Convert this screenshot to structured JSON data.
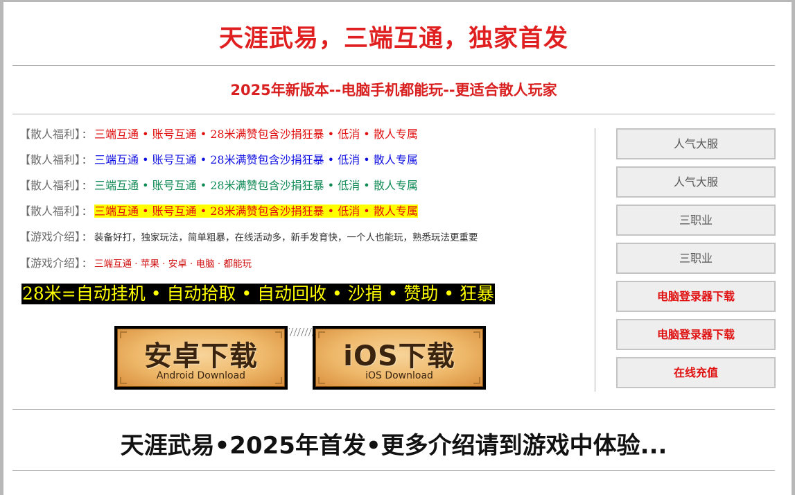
{
  "header": {
    "title": "天涯武易，三端互通，独家首发",
    "subtitle": "2025年新版本--电脑手机都能玩--更适合散人玩家"
  },
  "info_lines": [
    {
      "prefix": "【散人福利】",
      "sep": "：",
      "text": "三端互通 • 账号互通 • 28米满赞包含沙捐狂暴 • 低消 • 散人专属"
    },
    {
      "prefix": "【散人福利】",
      "sep": "：",
      "text": "三端互通 • 账号互通 • 28米满赞包含沙捐狂暴 • 低消 • 散人专属"
    },
    {
      "prefix": "【散人福利】",
      "sep": "：",
      "text": "三端互通 • 账号互通 • 28米满赞包含沙捐狂暴 • 低消 • 散人专属"
    },
    {
      "prefix": "【散人福利】",
      "sep": "：",
      "text": "三端互通 • 账号互通 • 28米满赞包含沙捐狂暴 • 低消 • 散人专属"
    },
    {
      "prefix": "【游戏介绍】",
      "sep": "：",
      "text": "装备好打，独家玩法，简单粗暴，在线活动多，新手发育快，一个人也能玩，熟悉玩法更重要"
    },
    {
      "prefix": "【游戏介绍】",
      "sep": "：",
      "text": "三端互通 · 苹果 · 安卓 · 电脑 · 都能玩"
    }
  ],
  "banner": "28米=自动挂机 • 自动拾取 • 自动回收 • 沙捐 • 赞助 • 狂暴",
  "downloads": {
    "android": {
      "main": "安卓下载",
      "sub": "Android Download"
    },
    "ios": {
      "main": "iOS下载",
      "sub": "iOS Download"
    }
  },
  "sidebar": {
    "buttons": [
      "人气大服",
      "人气大服",
      "三职业",
      "三职业",
      "电脑登录器下载",
      "电脑登录器下载",
      "在线充值"
    ]
  },
  "footer": "天涯武易•2025年首发•更多介绍请到游戏中体验...",
  "colors": {
    "title_red": "#e02020",
    "line_red": "#e01010",
    "line_blue": "#1010e0",
    "line_green": "#108a55",
    "highlight_yellow": "#ffff00",
    "banner_bg": "#000000",
    "banner_text": "#ffff00"
  }
}
